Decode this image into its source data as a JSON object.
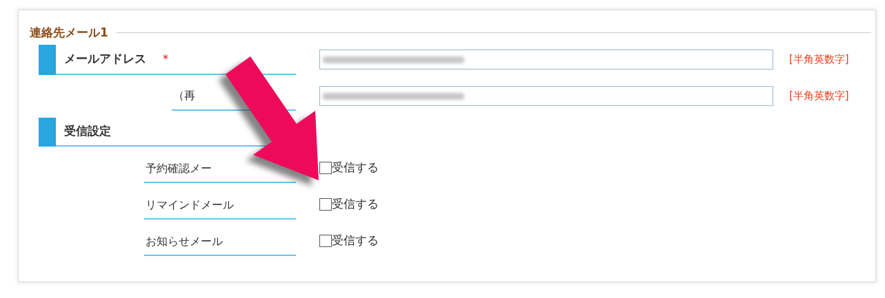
{
  "section": {
    "title": "連絡先メール1"
  },
  "email": {
    "label": "メールアドレス",
    "required_mark": "*",
    "hint": "[半角英数字]"
  },
  "email_confirm": {
    "label": "（再",
    "hint": "[半角英数字]"
  },
  "receive": {
    "title": "受信設定",
    "options": [
      {
        "label": "予約確認メー",
        "checkbox_label": "受信する",
        "checked": false
      },
      {
        "label": "リマインドメール",
        "checkbox_label": "受信する",
        "checked": false
      },
      {
        "label": "お知らせメール",
        "checkbox_label": "受信する",
        "checked": false
      }
    ]
  }
}
